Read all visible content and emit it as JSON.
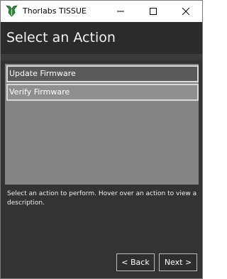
{
  "window": {
    "title": "Thorlabs TISSUE",
    "controls": {
      "minimize": "minimize",
      "maximize": "maximize",
      "close": "close"
    }
  },
  "header": {
    "title": "Select an Action"
  },
  "actions": {
    "items": [
      {
        "label": "Update Firmware",
        "selected": true
      },
      {
        "label": "Verify Firmware",
        "selected": false
      }
    ]
  },
  "description": {
    "text": "Select an action to perform. Hover over an action to view a description."
  },
  "navigation": {
    "back_label": "< Back",
    "next_label": "Next >"
  },
  "colors": {
    "window_bg": "#333333",
    "header_bg": "#2b2b2b",
    "list_bg": "#858585",
    "app_icon": "#2e7d32"
  },
  "icons": {
    "app": "thorlabs-logo-icon",
    "minimize": "minimize-icon",
    "maximize": "maximize-icon",
    "close": "close-icon"
  }
}
